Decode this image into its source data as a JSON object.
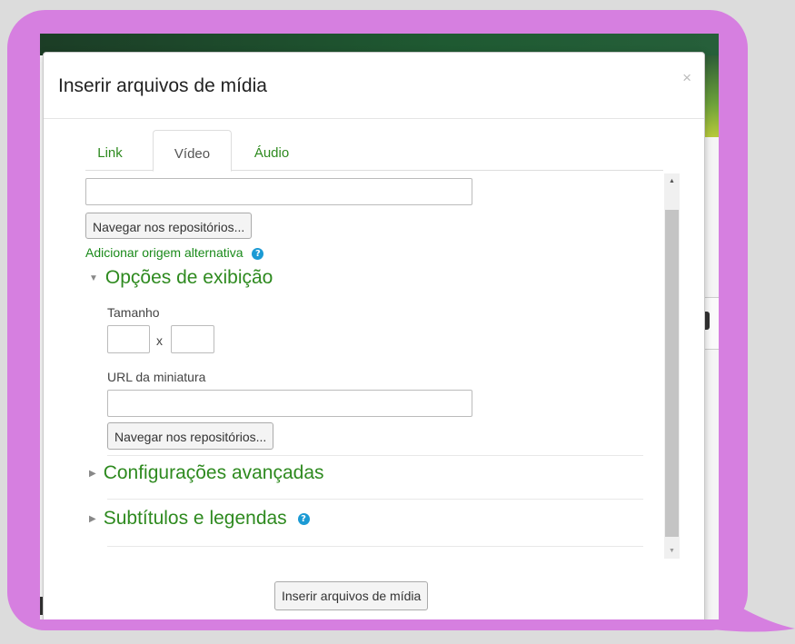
{
  "dialog": {
    "title": "Inserir arquivos de mídia",
    "close_glyph": "×",
    "tabs": [
      "Link",
      "Vídeo",
      "Áudio"
    ],
    "active_tab": "Vídeo",
    "browse_label_1": "Navegar nos repositórios...",
    "add_alt_source": "Adicionar origem alternativa",
    "display_options": {
      "heading": "Opções de exibição",
      "size_label": "Tamanho",
      "size_separator": "x",
      "thumbnail_label": "URL da miniatura",
      "browse_label": "Navegar nos repositórios..."
    },
    "advanced_heading": "Configurações avançadas",
    "subtitles_heading": "Subtítulos e legendas",
    "submit_label": "Inserir arquivos de mídia",
    "help_glyph": "?",
    "expanded_caret": "▼",
    "collapsed_caret": "▶",
    "scroll_up_glyph": "▲",
    "scroll_down_glyph": "▼"
  },
  "colors": {
    "accent_green": "#2e8a1f",
    "help_blue": "#1b9ad4",
    "frame_purple": "#d67fe0"
  }
}
